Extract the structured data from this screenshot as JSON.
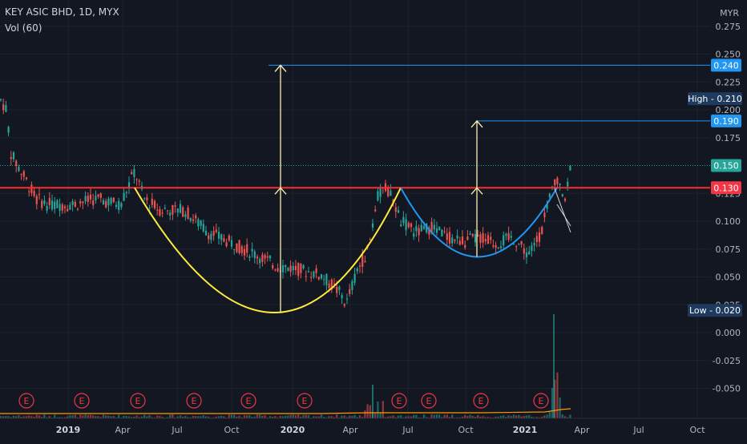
{
  "header": {
    "symbol": "KEY ASIC BHD, 1D, MYX",
    "indicator": "Vol (60)",
    "currency": "MYR"
  },
  "colors": {
    "background": "#131722",
    "up": "#26a69a",
    "down": "#ef5350",
    "grid": "#1e222d",
    "resistance": "#ff2b2b",
    "target": "#2196f3",
    "cup_yellow": "#ffeb3b",
    "cup_blue": "#2196f3",
    "arrow": "#fff2b3",
    "volume_ma": "#ff9800",
    "earnings": "#f23645"
  },
  "chart_data": {
    "type": "candlestick",
    "y_ticks": [
      "0.275",
      "0.250",
      "0.225",
      "0.200",
      "0.175",
      "0.125",
      "0.100",
      "0.075",
      "0.050",
      "0.025",
      "0.000",
      "-0.025",
      "-0.050"
    ],
    "ylim": [
      -0.07,
      0.29
    ],
    "x_ticks": [
      "2019",
      "Apr",
      "Jul",
      "Oct",
      "2020",
      "Apr",
      "Jul",
      "Oct",
      "2021",
      "Apr",
      "Jul",
      "Oct"
    ],
    "bold_x_ticks": [
      "2019",
      "2020",
      "2021"
    ],
    "price_tags": [
      {
        "label": "0.240",
        "value": 0.24,
        "color": "#2196f3"
      },
      {
        "label": "0.190",
        "value": 0.19,
        "color": "#2196f3"
      },
      {
        "label": "0.150",
        "value": 0.15,
        "color": "#26a69a"
      },
      {
        "label": "0.130",
        "value": 0.13,
        "color": "#f23645"
      }
    ],
    "high_label": {
      "text": "High - 0.210",
      "value": 0.21
    },
    "low_label": {
      "text": "Low - 0.020",
      "value": 0.02
    },
    "lines": [
      {
        "name": "resistance",
        "value": 0.13
      },
      {
        "name": "target-1",
        "value": 0.24
      },
      {
        "name": "target-2",
        "value": 0.19
      },
      {
        "name": "last-price",
        "value": 0.15
      }
    ],
    "cups": [
      {
        "name": "cup-1",
        "start": 0.13,
        "bottom": 0.018,
        "end": 0.13
      },
      {
        "name": "cup-2",
        "start": 0.13,
        "bottom": 0.068,
        "end": 0.13
      }
    ],
    "arrows": [
      {
        "name": "arrow-1-top",
        "from": 0.13,
        "to": 0.24
      },
      {
        "name": "arrow-1-depth",
        "from": 0.018,
        "to": 0.13
      },
      {
        "name": "arrow-2-top",
        "from": 0.13,
        "to": 0.19
      },
      {
        "name": "arrow-2-depth",
        "from": 0.068,
        "to": 0.13
      }
    ],
    "earnings_marker": "E",
    "earnings_count": 11
  }
}
